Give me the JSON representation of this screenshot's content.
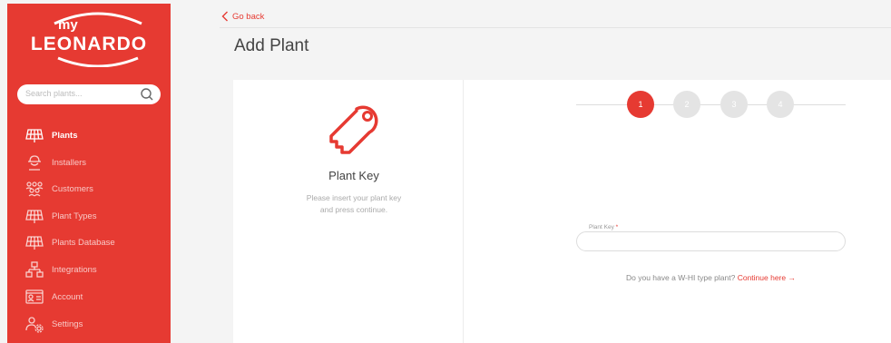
{
  "brand": {
    "logo_top": "my",
    "logo_main": "LEONARDO",
    "accent": "#e63a32"
  },
  "search": {
    "placeholder": "Search plants..."
  },
  "sidebar": {
    "items": [
      {
        "label": "Plants",
        "icon": "solar-panel-icon",
        "active": true
      },
      {
        "label": "Installers",
        "icon": "worker-helmet-icon",
        "active": false
      },
      {
        "label": "Customers",
        "icon": "people-group-icon",
        "active": false
      },
      {
        "label": "Plant Types",
        "icon": "solar-panel-icon",
        "active": false
      },
      {
        "label": "Plants Database",
        "icon": "solar-panel-icon",
        "active": false
      },
      {
        "label": "Integrations",
        "icon": "network-icon",
        "active": false
      },
      {
        "label": "Account",
        "icon": "id-card-icon",
        "active": false
      },
      {
        "label": "Settings",
        "icon": "user-settings-icon",
        "active": false
      }
    ]
  },
  "header": {
    "back_label": "Go back",
    "title": "Add Plant"
  },
  "left_panel": {
    "icon": "key-icon",
    "title": "Plant Key",
    "description_line1": "Please insert your plant key",
    "description_line2": "and press continue."
  },
  "stepper": {
    "steps": [
      "1",
      "2",
      "3",
      "4"
    ],
    "current": 1
  },
  "form": {
    "plant_key_label": "Plant Key",
    "required_mark": "*",
    "plant_key_value": ""
  },
  "whi": {
    "text": "Do you have a W-HI type plant?",
    "link": "Continue here →"
  }
}
